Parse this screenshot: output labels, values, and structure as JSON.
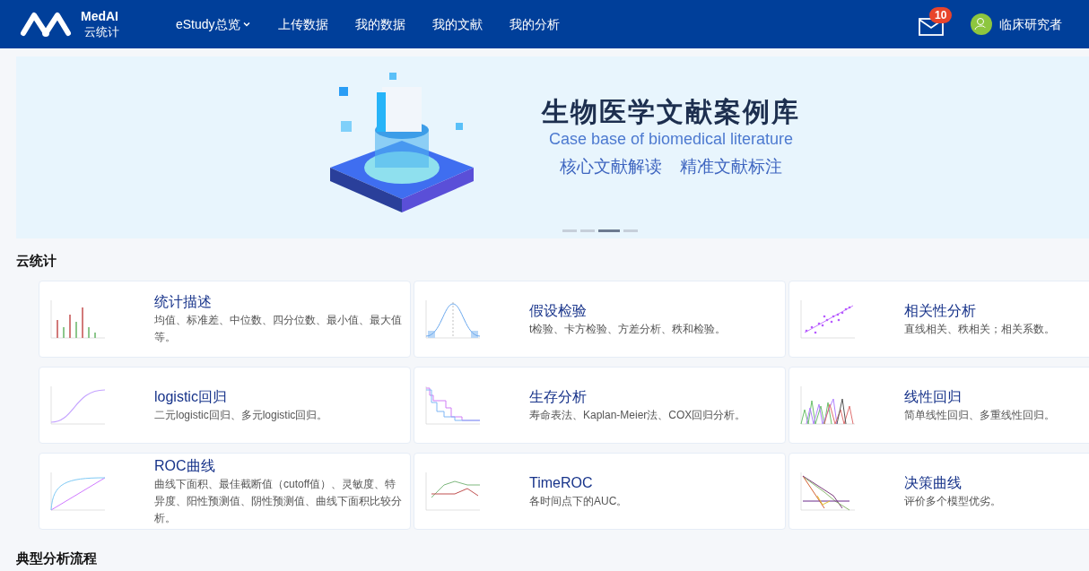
{
  "header": {
    "brand": "MedAI",
    "subtitle": "云统计",
    "nav": [
      {
        "label": "eStudy总览",
        "dropdown": true
      },
      {
        "label": "上传数据",
        "dropdown": false
      },
      {
        "label": "我的数据",
        "dropdown": false
      },
      {
        "label": "我的文献",
        "dropdown": false
      },
      {
        "label": "我的分析",
        "dropdown": false
      }
    ],
    "mail_count": "10",
    "user": "临床研究者"
  },
  "banner": {
    "title": "生物医学文献案例库",
    "subtitle": "Case base of biomedical literature",
    "tags": [
      "核心文献解读",
      "精准文献标注"
    ],
    "dots": [
      {
        "selected": false
      },
      {
        "selected": false
      },
      {
        "selected": true
      },
      {
        "selected": false
      }
    ]
  },
  "section": {
    "title": "云统计"
  },
  "cards": [
    {
      "kind": "bars",
      "title": "统计描述",
      "desc": "均值、标准差、中位数、四分位数、最小值、最大值等。"
    },
    {
      "kind": "bell",
      "title": "假设检验",
      "desc": "t检验、卡方检验、方差分析、秩和检验。"
    },
    {
      "kind": "scatter",
      "title": "相关性分析",
      "desc": "直线相关、秩相关；相关系数。"
    },
    {
      "kind": "sigmoid",
      "title": "logistic回归",
      "desc": "二元logistic回归、多元logistic回归。"
    },
    {
      "kind": "survival",
      "title": "生存分析",
      "desc": "寿命表法、Kaplan-Meier法、COX回归分析。"
    },
    {
      "kind": "wave",
      "title": "线性回归",
      "desc": "简单线性回归、多重线性回归。"
    },
    {
      "kind": "roc",
      "title": "ROC曲线",
      "desc": "曲线下面积、最佳截断值（cutoff值）、灵敏度、特异度、阳性预测值、阴性预测值、曲线下面积比较分析。"
    },
    {
      "kind": "timeroc",
      "title": "TimeROC",
      "desc": "各时间点下的AUC。"
    },
    {
      "kind": "decision",
      "title": "决策曲线",
      "desc": "评价多个模型优劣。"
    }
  ],
  "next_section": {
    "title": "典型分析流程"
  }
}
